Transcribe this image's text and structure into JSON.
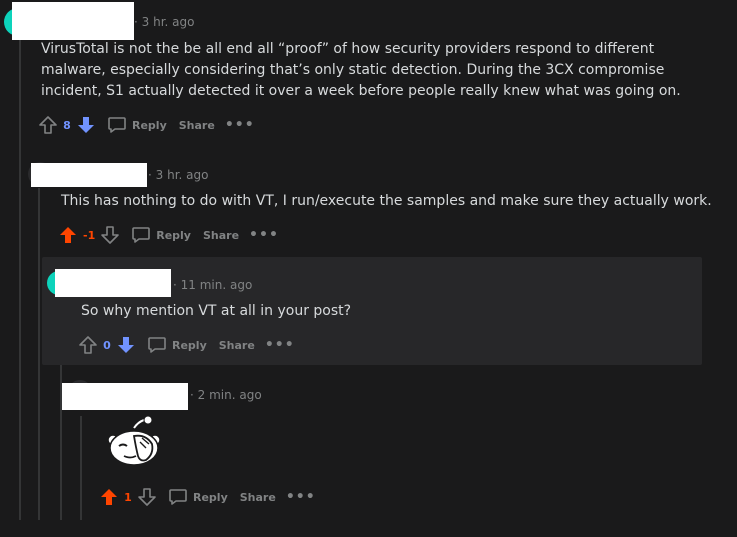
{
  "comments": [
    {
      "timestamp": "3 hr. ago",
      "text": "VirusTotal is not the be all end all “proof” of how security providers respond to different malware, especially considering that’s only static detection. During the 3CX compromise incident, S1 actually detected it over a week before people really knew what was going on.",
      "score": "8",
      "vote_state": "downvoted",
      "score_color": "#7193ff"
    },
    {
      "timestamp": "3 hr. ago",
      "text": "This has nothing to do with VT, I run/execute the samples and make sure they actually work.",
      "score": "-1",
      "vote_state": "upvoted",
      "score_color": "#ff4500"
    },
    {
      "timestamp": "11 min. ago",
      "text": "So why mention VT at all in your post?",
      "score": "0",
      "vote_state": "downvoted",
      "score_color": "#7193ff"
    },
    {
      "timestamp": "2 min. ago",
      "text": "",
      "score": "1",
      "vote_state": "upvoted",
      "score_color": "#ff4500"
    }
  ],
  "actions": {
    "reply": "Reply",
    "share": "Share",
    "more": "•••"
  },
  "colors": {
    "upvote": "#ff4500",
    "downvote": "#7193ff",
    "neutral": "#818384"
  },
  "separator": "·",
  "facepalm_icon": "snoo-facepalm-icon"
}
